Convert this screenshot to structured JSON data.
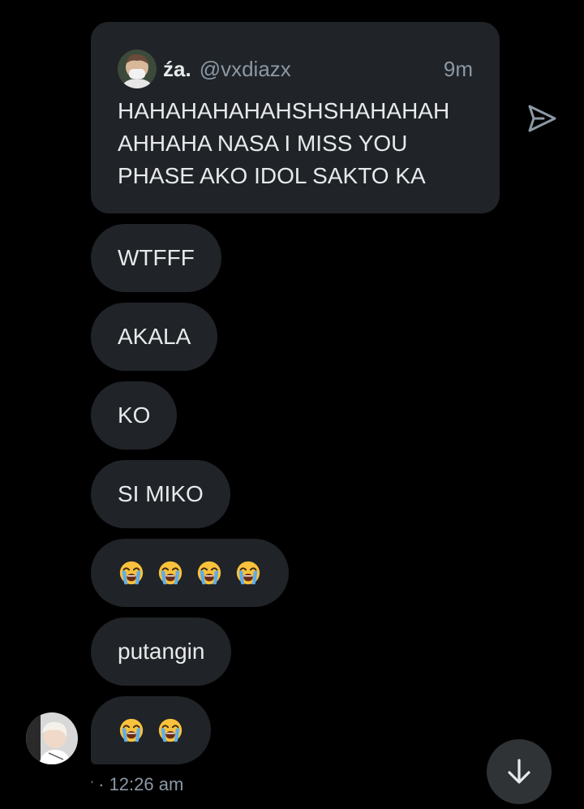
{
  "quoted_tweet": {
    "display_name": "źa.",
    "handle": "@vxdiazx",
    "time": "9m",
    "text": "HAHAHAHAHAHSHSHAHAHAH\nAHHAHA NASA I MISS YOU\nPHASE AKO IDOL SAKTO KA",
    "avatar_icon": "masked-person-avatar"
  },
  "messages": [
    {
      "text": "WTFFF"
    },
    {
      "text": "AKALA"
    },
    {
      "text": "KO"
    },
    {
      "text": "SI MIKO"
    },
    {
      "emojis": [
        "loudly-crying-face",
        "loudly-crying-face",
        "loudly-crying-face",
        "loudly-crying-face"
      ]
    },
    {
      "text": "putangin"
    },
    {
      "emojis": [
        "loudly-crying-face",
        "loudly-crying-face"
      ]
    }
  ],
  "footer": {
    "seen_mark": "ʻ",
    "time": "· 12:26 am"
  },
  "icons": {
    "share": "send-icon",
    "scroll": "arrow-down-icon"
  },
  "colors": {
    "background": "#000000",
    "bubble": "#202327",
    "text": "#e7e9ea",
    "muted": "#8b98a5"
  }
}
